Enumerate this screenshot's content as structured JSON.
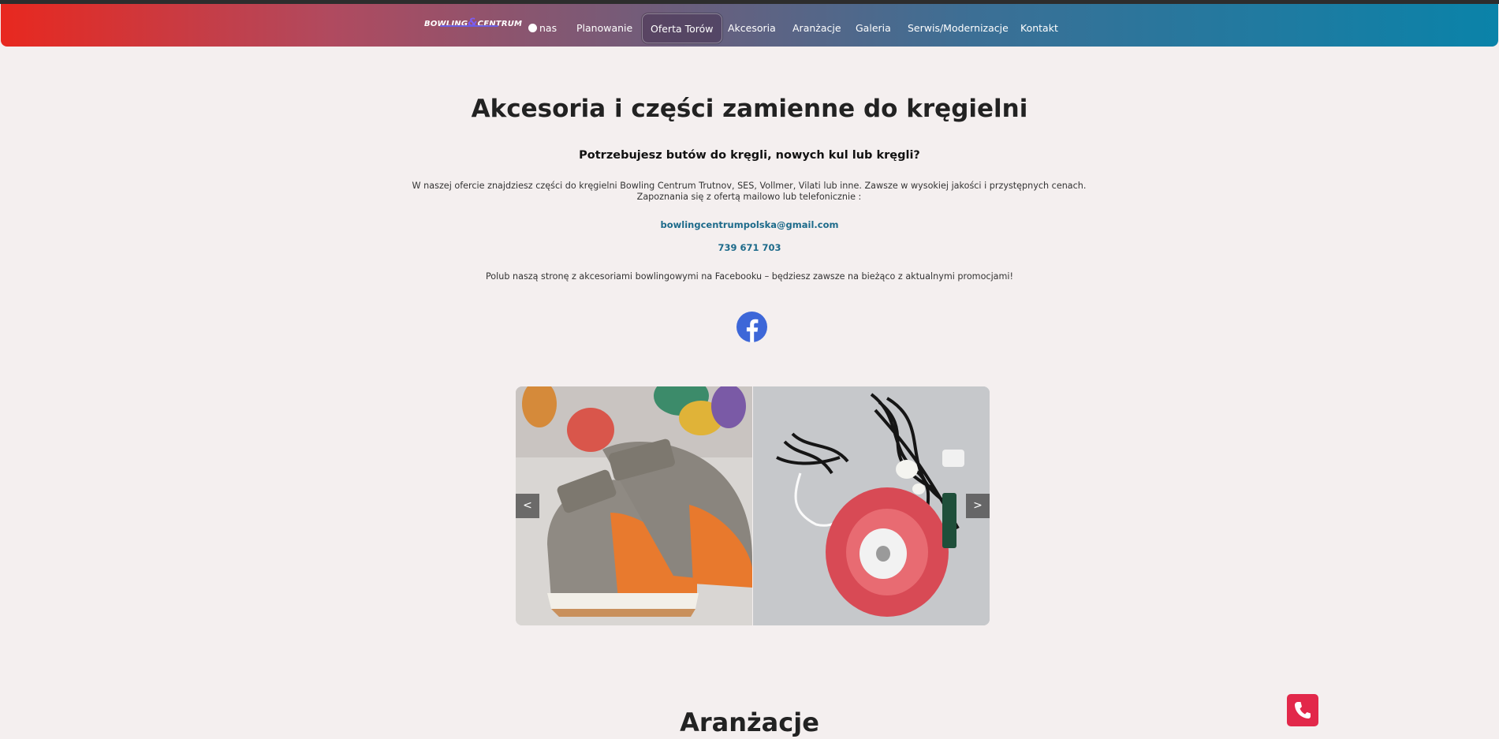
{
  "nav": {
    "logo_text_1": "BOWLING",
    "logo_text_amp": "&",
    "logo_text_2": "CENTRUM",
    "items": [
      {
        "label": "nas"
      },
      {
        "label": "Planowanie"
      },
      {
        "label": "Oferta Torów"
      },
      {
        "label": "Akcesoria"
      },
      {
        "label": "Aranżacje"
      },
      {
        "label": "Galeria"
      },
      {
        "label": "Serwis/Modernizacje"
      },
      {
        "label": "Kontakt"
      }
    ],
    "active_item": "Oferta Torów"
  },
  "main": {
    "title": "Akcesoria i części zamienne do kręgielni",
    "subtitle": "Potrzebujesz butów do kręgli, nowych kul lub kręgli?",
    "description_line1": "W naszej ofercie znajdziesz części do kręgielni Bowling Centrum Trutnov, SES, Vollmer, Vilati lub inne. Zawsze w wysokiej jakości i przystępnych cenach.",
    "description_line2": "Zapoznania się z ofertą mailowo lub telefonicznie :",
    "email": "bowlingcentrumpolska@gmail.com",
    "phone": "739 671 703",
    "facebook_text": "Polub naszą stronę z akcesoriami bowlingowymi na Facebooku – będziesz zawsze na bieżąco z aktualnymi promocjami!",
    "facebook_icon": "facebook-icon"
  },
  "carousel": {
    "prev_label": "<",
    "next_label": ">",
    "slides": [
      {
        "icon": "bowling-shoes-image"
      },
      {
        "icon": "pinsetter-parts-image"
      }
    ]
  },
  "next_section": {
    "title": "Aranżacje"
  },
  "floating": {
    "phone_icon": "phone-icon"
  },
  "colors": {
    "nav_gradient_start": "#e8281f",
    "nav_gradient_end": "#0a83a9",
    "link": "#1c6a8a",
    "facebook": "#3d67d8",
    "phone_button": "#e2284a",
    "background": "#f4efef"
  }
}
